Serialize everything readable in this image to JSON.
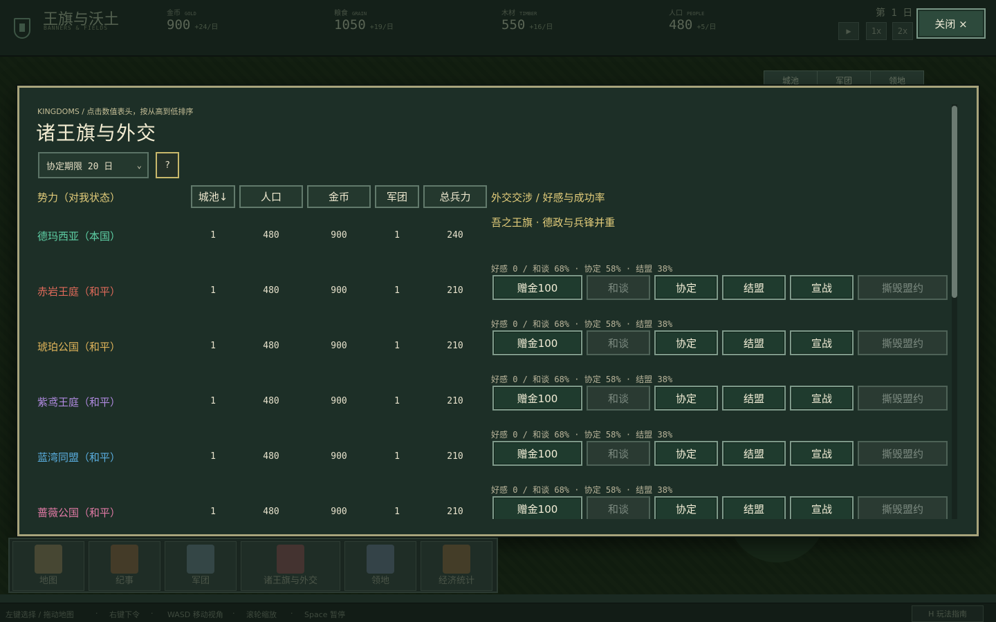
{
  "hud": {
    "title": "王旗与沃土",
    "subtitle": "BANNERS & FIELDS",
    "resources": [
      {
        "label": "金币",
        "en": "GOLD",
        "value": "900",
        "rate": "+24/日"
      },
      {
        "label": "粮食",
        "en": "GRAIN",
        "value": "1050",
        "rate": "+19/日"
      },
      {
        "label": "木材",
        "en": "TIMBER",
        "value": "550",
        "rate": "+16/日"
      },
      {
        "label": "人口",
        "en": "PEOPLE",
        "value": "480",
        "rate": "+5/日"
      }
    ],
    "day": "第 1 日",
    "speed": [
      "▶",
      "1x",
      "2x"
    ],
    "close_label": "关闭 ×"
  },
  "side_tabs": [
    "城池",
    "军团",
    "领地"
  ],
  "modal": {
    "breadcrumb": "KINGDOMS / 点击数值表头，按从高到低排序",
    "title": "诸王旗与外交",
    "term_select": "协定期限 20 日",
    "term_chevron": "⌄",
    "help_label": "?",
    "faction_header": "势力（对我状态）",
    "sort_headers": [
      "城池↓",
      "人口",
      "金币",
      "军团",
      "总兵力"
    ],
    "diplo_header": "外交交涉 / 好感与成功率",
    "own_banner": "吾之王旗 · 德政与兵锋并重",
    "rows": [
      {
        "name": "德玛西亚（本国）",
        "color": "#5ecfa5",
        "cities": "1",
        "population": "480",
        "gold": "900",
        "legions": "1",
        "troops": "240",
        "self": true
      },
      {
        "name": "赤岩王庭（和平）",
        "color": "#e06a5a",
        "cities": "1",
        "population": "480",
        "gold": "900",
        "legions": "1",
        "troops": "210",
        "odds": "好感 0  /  和谈 68%  ·  协定 58%  ·  结盟 38%"
      },
      {
        "name": "琥珀公国（和平）",
        "color": "#e0b45a",
        "cities": "1",
        "population": "480",
        "gold": "900",
        "legions": "1",
        "troops": "210",
        "odds": "好感 0  /  和谈 68%  ·  协定 58%  ·  结盟 38%"
      },
      {
        "name": "紫鸢王庭（和平）",
        "color": "#b08ae0",
        "cities": "1",
        "population": "480",
        "gold": "900",
        "legions": "1",
        "troops": "210",
        "odds": "好感 0  /  和谈 68%  ·  协定 58%  ·  结盟 38%"
      },
      {
        "name": "蓝湾同盟（和平）",
        "color": "#5aaee0",
        "cities": "1",
        "population": "480",
        "gold": "900",
        "legions": "1",
        "troops": "210",
        "odds": "好感 0  /  和谈 68%  ·  协定 58%  ·  结盟 38%"
      },
      {
        "name": "蔷薇公国（和平）",
        "color": "#e07aa5",
        "cities": "1",
        "population": "480",
        "gold": "900",
        "legions": "1",
        "troops": "210",
        "odds": "好感 0  /  和谈 68%  ·  协定 58%  ·  结盟 38%"
      }
    ],
    "actions": [
      {
        "label": "赠金100",
        "enabled": true
      },
      {
        "label": "和谈",
        "enabled": false
      },
      {
        "label": "协定",
        "enabled": true
      },
      {
        "label": "结盟",
        "enabled": true
      },
      {
        "label": "宣战",
        "enabled": true
      },
      {
        "label": "撕毁盟约",
        "enabled": false
      }
    ]
  },
  "bottom_nav": [
    {
      "label": "地图",
      "icon": "map-icon",
      "color": "#6f6140"
    },
    {
      "label": "纪事",
      "icon": "book-icon",
      "color": "#6a4a2a"
    },
    {
      "label": "军团",
      "icon": "helmet-icon",
      "color": "#4a5f66"
    },
    {
      "label": "诸王旗与外交",
      "icon": "banners-icon",
      "color": "#6a3a3a"
    },
    {
      "label": "领地",
      "icon": "castle-icon",
      "color": "#4a5a6a"
    },
    {
      "label": "经济统计",
      "icon": "coins-icon",
      "color": "#6a4e2a"
    }
  ],
  "status_hints": [
    "左键选择 / 拖动地图",
    "·",
    "右键下令",
    "·",
    "WASD 移动视角",
    "·",
    "滚轮缩放",
    "·",
    "Space 暂停"
  ],
  "guide": "H  玩法指南"
}
